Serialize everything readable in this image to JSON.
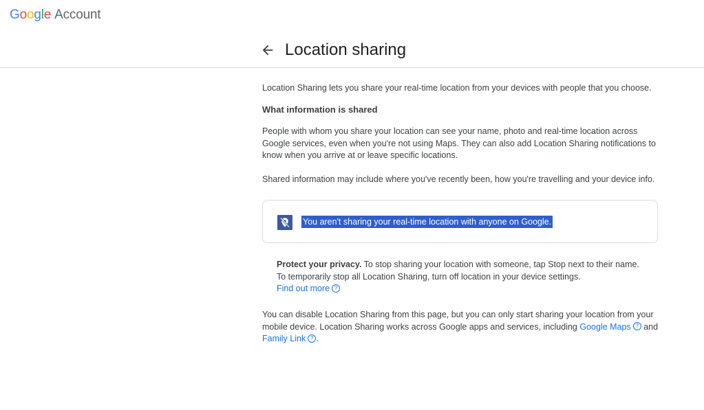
{
  "brand": {
    "g1": "G",
    "g2": "o",
    "g3": "o",
    "g4": "g",
    "g5": "l",
    "g6": "e",
    "account": "Account"
  },
  "header": {
    "title": "Location sharing",
    "back_icon": "arrow-left-icon"
  },
  "content": {
    "intro": "Location Sharing lets you share your real-time location from your devices with people that you choose.",
    "section_heading": "What information is shared",
    "para_visibility": "People with whom you share your location can see your name, photo and real-time location across Google services, even when you're not using Maps. They can also add Location Sharing notifications to know when you arrive at or leave specific locations.",
    "para_shared_info": "Shared information may include where you've recently been, how you're travelling and your device info.",
    "status_card": {
      "icon": "location-off-icon",
      "message": "You aren't sharing your real-time location with anyone on Google."
    },
    "privacy": {
      "bold": "Protect your privacy.",
      "line1": " To stop sharing your location with someone, tap Stop next to their name.",
      "line2": "To temporarily stop all Location Sharing, turn off location in your device settings.",
      "find_out_more": "Find out more"
    },
    "footer": {
      "text1": "You can disable Location Sharing from this page, but you can only start sharing your location from your mobile device. Location Sharing works across Google apps and services, including ",
      "google_maps": "Google Maps",
      "and": " and",
      "family_link": "Family Link",
      "period": "."
    }
  },
  "colors": {
    "link": "#1a73e8",
    "highlight": "#2f5fcc",
    "divider": "#dadce0"
  }
}
